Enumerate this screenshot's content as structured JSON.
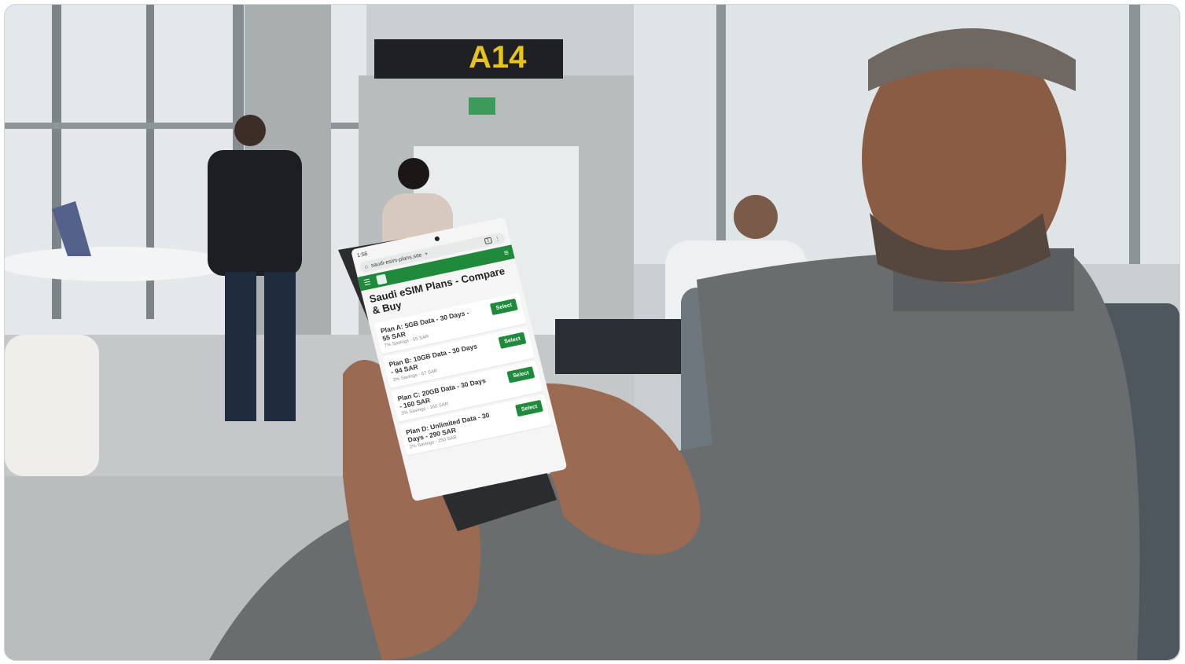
{
  "scene": {
    "gate_sign": "A14"
  },
  "phone": {
    "status_time": "1:56",
    "url": "saudi-esim-plans.site",
    "tab_count": "1",
    "page_title": "Saudi eSIM Plans - Compare & Buy",
    "select_label": "Select",
    "plans": [
      {
        "name": "Plan A: 5GB Data - 30 Days - 55 SAR",
        "detail": "7% Savings - 55 SAR"
      },
      {
        "name": "Plan B: 10GB Data - 30 Days - 94 SAR",
        "detail": "3% Savings - 67 SAR"
      },
      {
        "name": "Plan C: 20GB Data - 30 Days - 160 SAR",
        "detail": "3% Savings - 160 SAR"
      },
      {
        "name": "Plan D: Unlimited Data - 30 Days - 290 SAR",
        "detail": "2% Savings - 250 SAR"
      }
    ]
  },
  "colors": {
    "brand_green": "#1f8a3b",
    "sign_yellow": "#e8c31c"
  }
}
